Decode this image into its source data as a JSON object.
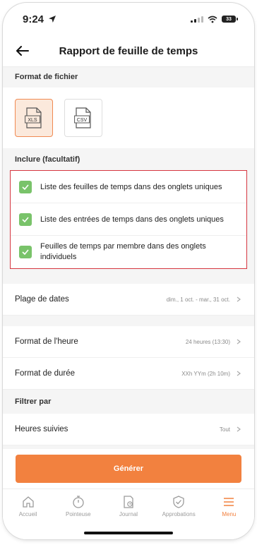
{
  "status": {
    "time": "9:24",
    "battery": "33"
  },
  "header": {
    "title": "Rapport de feuille de temps"
  },
  "format_section": {
    "title": "Format de fichier",
    "options": [
      {
        "label": "XLS",
        "selected": true
      },
      {
        "label": "CSV",
        "selected": false
      }
    ]
  },
  "include_section": {
    "title": "Inclure (facultatif)",
    "items": [
      {
        "label": "Liste des feuilles de temps dans des onglets uniques",
        "checked": true
      },
      {
        "label": "Liste des entrées de temps dans des onglets uniques",
        "checked": true
      },
      {
        "label": "Feuilles de temps par membre dans des onglets individuels",
        "checked": true
      }
    ]
  },
  "settings": {
    "date_range": {
      "label": "Plage de dates",
      "value": "dim., 1 oct. - mar., 31 oct."
    },
    "hour_format": {
      "label": "Format de l'heure",
      "value": "24 heures (13:30)"
    },
    "duration_format": {
      "label": "Format de durée",
      "value": "XXh YYm (2h 10m)"
    }
  },
  "filter_section": {
    "title": "Filtrer par",
    "tracked_hours": {
      "label": "Heures suivies",
      "value": "Tout"
    }
  },
  "actions": {
    "generate_label": "Générer"
  },
  "tabbar": {
    "items": [
      {
        "label": "Accueil",
        "icon": "home-icon"
      },
      {
        "label": "Pointeuse",
        "icon": "stopwatch-icon"
      },
      {
        "label": "Journal",
        "icon": "timesheet-icon"
      },
      {
        "label": "Approbations",
        "icon": "approval-shield-icon"
      },
      {
        "label": "Menu",
        "icon": "menu-icon",
        "active": true
      }
    ]
  },
  "colors": {
    "accent": "#f2813f",
    "check": "#79c36a",
    "highlight_border": "#d6363f"
  }
}
